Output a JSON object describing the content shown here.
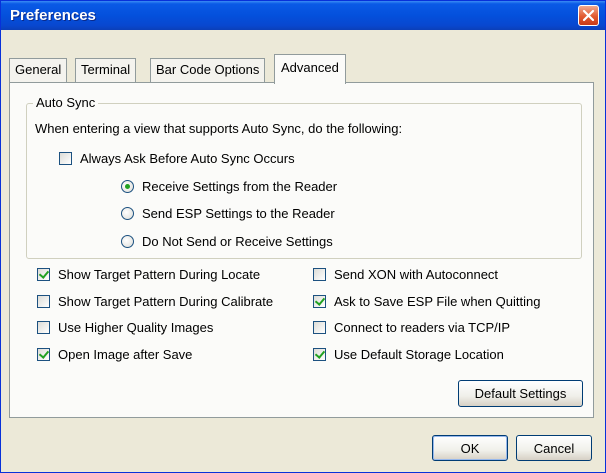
{
  "window": {
    "title": "Preferences"
  },
  "tabs": [
    {
      "label": "General"
    },
    {
      "label": "Terminal"
    },
    {
      "label": "Bar Code Options"
    },
    {
      "label": "Advanced",
      "selected": true
    }
  ],
  "auto_sync": {
    "legend": "Auto Sync",
    "description": "When entering a view that supports Auto Sync, do the following:",
    "always_ask": {
      "label": "Always Ask Before Auto Sync Occurs",
      "checked": false
    },
    "options": [
      {
        "label": "Receive Settings from the Reader",
        "selected": true
      },
      {
        "label": "Send ESP Settings to the Reader",
        "selected": false
      },
      {
        "label": "Do Not Send or Receive Settings",
        "selected": false
      }
    ]
  },
  "options_left": [
    {
      "label": "Show Target Pattern During Locate",
      "checked": true
    },
    {
      "label": "Show Target Pattern During Calibrate",
      "checked": false
    },
    {
      "label": "Use Higher Quality Images",
      "checked": false
    },
    {
      "label": "Open Image after Save",
      "checked": true
    }
  ],
  "options_right": [
    {
      "label": "Send XON with Autoconnect",
      "checked": false
    },
    {
      "label": "Ask to Save ESP File when Quitting",
      "checked": true
    },
    {
      "label": "Connect to readers via TCP/IP",
      "checked": false
    },
    {
      "label": "Use Default Storage Location",
      "checked": true
    }
  ],
  "buttons": {
    "default_settings": "Default Settings",
    "ok": "OK",
    "cancel": "Cancel"
  },
  "colors": {
    "titlebar": "#0450dc",
    "dialog_bg": "#ece9d8",
    "panel_bg": "#fbfbf9",
    "check_mark": "#21a121"
  }
}
